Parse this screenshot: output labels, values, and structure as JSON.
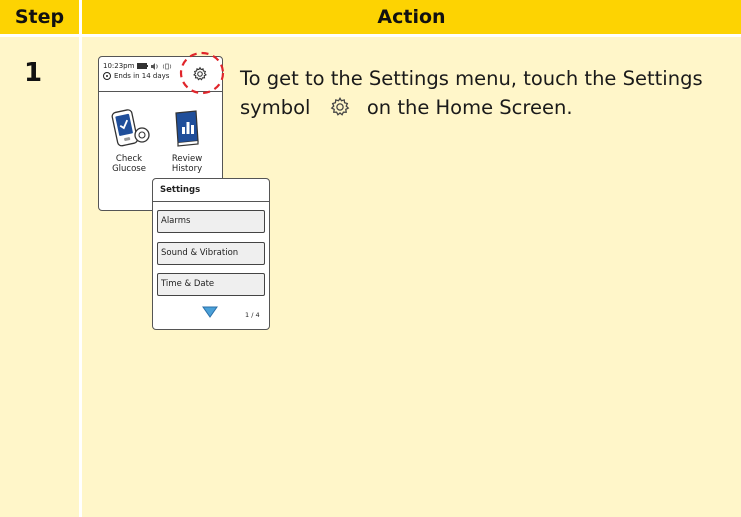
{
  "header": {
    "step_label": "Step",
    "action_label": "Action"
  },
  "step": {
    "number": "1"
  },
  "instruction": {
    "part1": "To get to the Settings menu, touch the Settings symbol",
    "part2": "on the Home Screen.",
    "icon": "gear-icon"
  },
  "home_screen": {
    "time": "10:23pm",
    "sensor_status": "Ends in 14 days",
    "apps": [
      {
        "label_line1": "Check",
        "label_line2": "Glucose",
        "icon": "reader-sensor-icon"
      },
      {
        "label_line1": "Review",
        "label_line2": "History",
        "icon": "book-chart-icon"
      }
    ]
  },
  "settings_screen": {
    "title": "Settings",
    "items": [
      "Alarms",
      "Sound & Vibration",
      "Time & Date"
    ],
    "page": "1 / 4"
  },
  "colors": {
    "header_yellow": "#fdd302",
    "column_cream": "#fff6c9",
    "highlight_red": "#e0252b",
    "arrow_blue": "#4aa0d8",
    "book_blue": "#1f4e9a"
  }
}
